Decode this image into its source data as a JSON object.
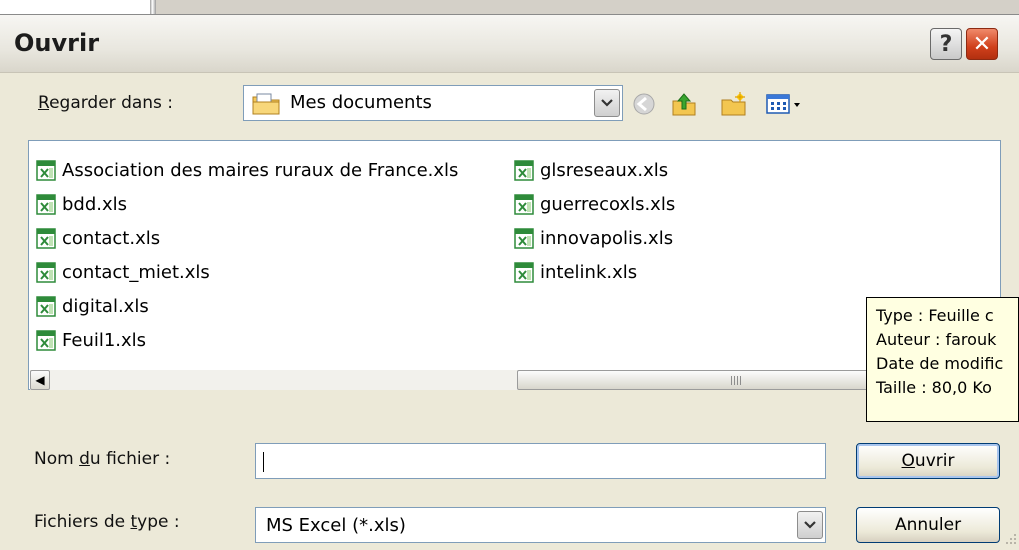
{
  "dialog": {
    "title": "Ouvrir",
    "help_glyph": "?",
    "close_glyph": "✕"
  },
  "lookin": {
    "label_prefix": "",
    "label_key": "R",
    "label_rest": "egarder dans :",
    "value": "Mes documents",
    "icon": "folder-icon"
  },
  "toolbar": {
    "icons": [
      "back-icon",
      "up-folder-icon",
      "new-folder-icon",
      "views-menu-icon"
    ]
  },
  "files": {
    "column1": [
      "Association des maires ruraux de France.xls",
      "bdd.xls",
      "contact.xls",
      "contact_miet.xls",
      "digital.xls",
      "Feuil1.xls"
    ],
    "column2": [
      "glsreseaux.xls",
      "guerrecoxls.xls",
      "innovapolis.xls",
      "intelink.xls"
    ]
  },
  "tooltip": {
    "lines": [
      "Type : Feuille c",
      "Auteur : farouk",
      "Date de modific",
      "Taille  : 80,0 Ko"
    ]
  },
  "filename": {
    "label_prefix": "Nom ",
    "label_key": "d",
    "label_rest": "u fichier :",
    "value": ""
  },
  "filetype": {
    "label_prefix": "Fichiers de ",
    "label_key": "t",
    "label_rest": "ype :",
    "value": "MS Excel (*.xls)"
  },
  "buttons": {
    "open_key": "O",
    "open_rest": "uvrir",
    "cancel": "Annuler"
  },
  "scrollbar": {
    "left_arrow": "◀"
  },
  "colors": {
    "dialog_bg": "#ece9d8",
    "close_red": "#d0401b",
    "tooltip_bg": "#ffffe1",
    "excel_green": "#2e8b3a"
  }
}
